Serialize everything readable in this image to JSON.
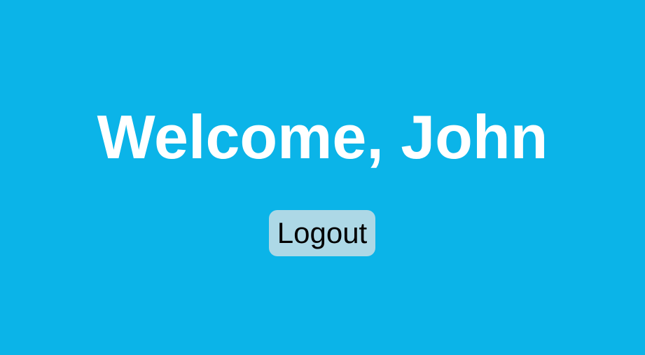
{
  "page": {
    "background_color": "#0bb4e8"
  },
  "welcome": {
    "text": "Welcome, John"
  },
  "logout_button": {
    "label": "Logout",
    "background_color": "#add8e6"
  }
}
